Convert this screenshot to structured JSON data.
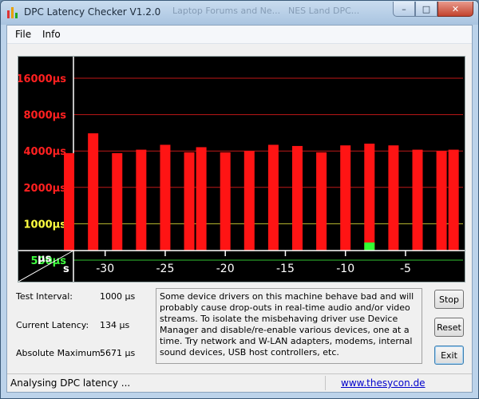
{
  "window": {
    "title": "DPC Latency Checker V1.2.0",
    "background_tabs": [
      "Laptop Forums and Ne...",
      "NES Land DPC..."
    ],
    "controls": {
      "minimize": "–",
      "maximize": "□",
      "close": "✕"
    }
  },
  "menu": {
    "file": "File",
    "info": "Info"
  },
  "chart_data": {
    "type": "bar",
    "title": "",
    "ylabel": "µs",
    "xlabel": "s",
    "y_scale": "log2",
    "y_ticks": [
      {
        "label": "16000µs",
        "value": 16000,
        "color": "#ff2020"
      },
      {
        "label": "8000µs",
        "value": 8000,
        "color": "#ff2020"
      },
      {
        "label": "4000µs",
        "value": 4000,
        "color": "#ff2020"
      },
      {
        "label": "2000µs",
        "value": 2000,
        "color": "#ff2020"
      },
      {
        "label": "1000µs",
        "value": 1000,
        "color": "#ffff40"
      },
      {
        "label": "500µs",
        "value": 500,
        "color": "#40ff40"
      }
    ],
    "x_ticks": [
      {
        "label": "-30",
        "value": -30
      },
      {
        "label": "-25",
        "value": -25
      },
      {
        "label": "-20",
        "value": -20
      },
      {
        "label": "-15",
        "value": -15
      },
      {
        "label": "-10",
        "value": -10
      },
      {
        "label": "-5",
        "value": -5
      }
    ],
    "bar_times": [
      -33,
      -31,
      -29,
      -27,
      -25,
      -23,
      -22,
      -20,
      -18,
      -16,
      -14,
      -12,
      -10,
      -8,
      -6,
      -4,
      -2,
      -1
    ],
    "series": [
      {
        "color": "#ff1414",
        "values": [
          3840,
          5600,
          3840,
          4100,
          4500,
          3900,
          4300,
          3900,
          4000,
          4500,
          4400,
          3900,
          4450,
          4600,
          4450,
          4100,
          4000,
          4100
        ]
      },
      {
        "color": "#33ff33",
        "values": [
          140,
          150,
          140,
          150,
          150,
          150,
          140,
          140,
          150,
          150,
          150,
          140,
          170,
          700,
          150,
          160,
          150,
          150
        ]
      }
    ],
    "grid": true
  },
  "info": {
    "test_interval_label": "Test Interval:",
    "test_interval_value": "1000 µs",
    "current_latency_label": "Current Latency:",
    "current_latency_value": "134 µs",
    "absolute_max_label": "Absolute Maximum:",
    "absolute_max_value": "5671 µs"
  },
  "message": "Some device drivers on this machine behave bad and will probably cause drop-outs in real-time audio and/or video streams. To isolate the misbehaving driver use Device Manager and disable/re-enable various devices, one at a time. Try network and W-LAN adapters, modems, internal sound devices, USB host controllers, etc.",
  "buttons": {
    "stop": "Stop",
    "reset": "Reset",
    "exit": "Exit"
  },
  "status": {
    "text": "Analysing DPC latency ...",
    "link": "www.thesycon.de"
  }
}
